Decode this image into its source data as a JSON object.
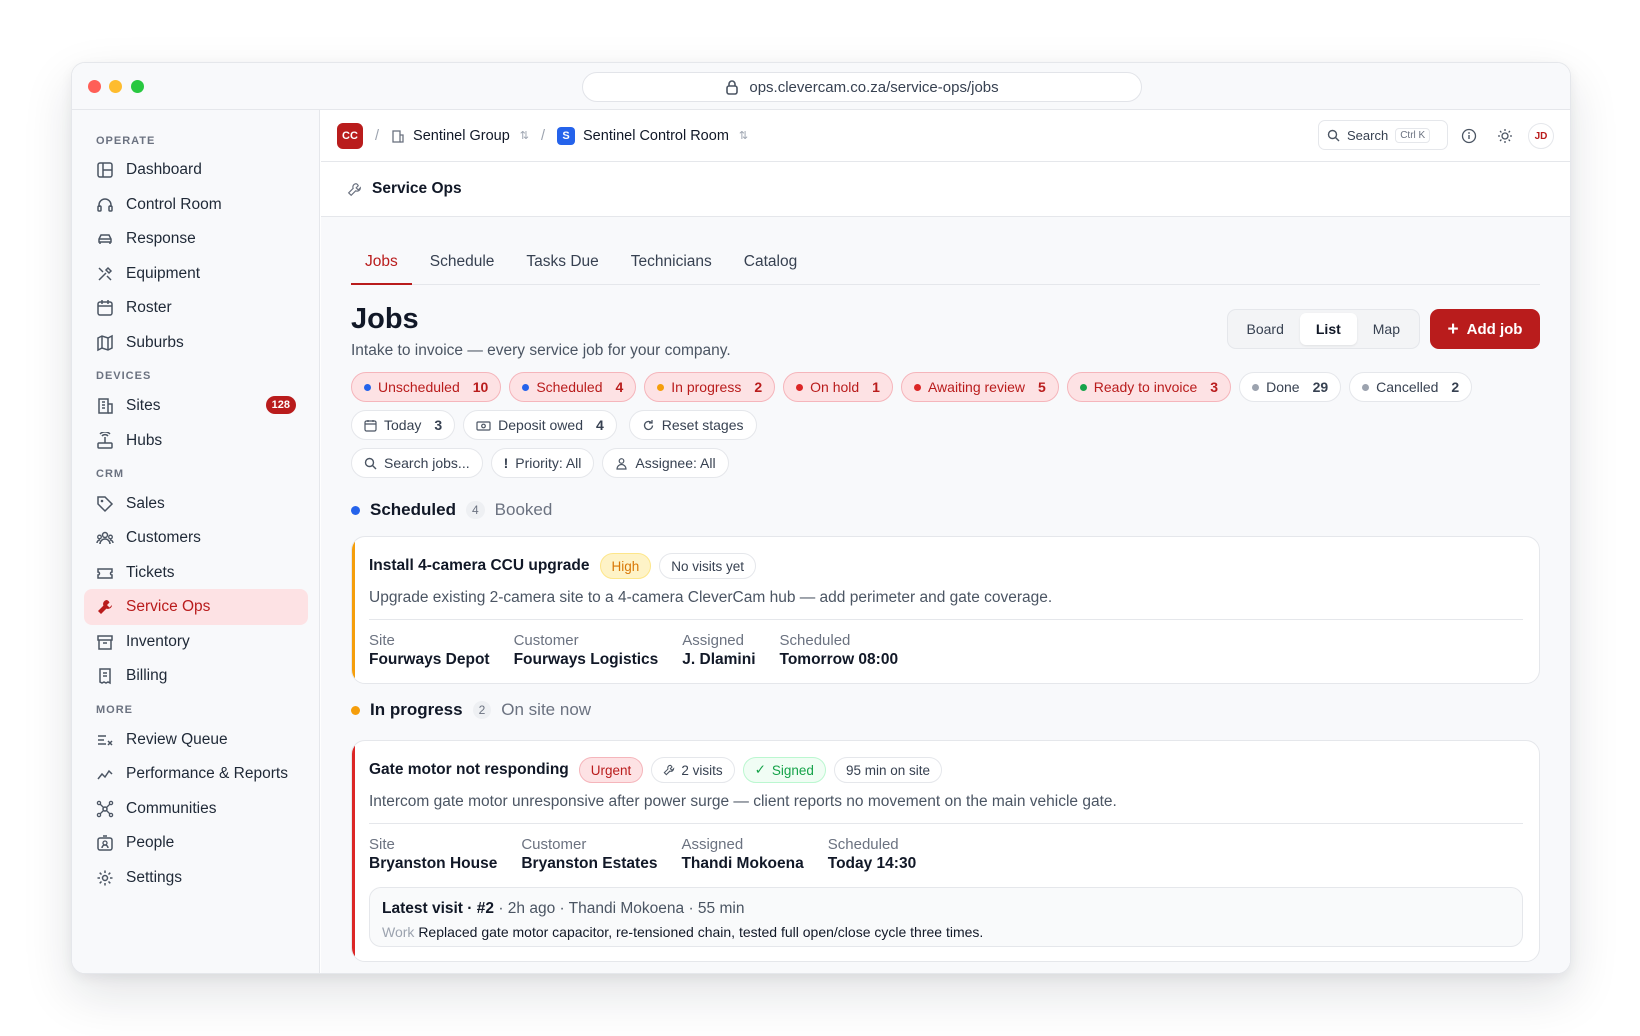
{
  "browser": {
    "url": "ops.clevercam.co.za/service-ops/jobs"
  },
  "sidebar": {
    "sections": [
      {
        "title": "OPERATE"
      },
      {
        "title": "DEVICES"
      },
      {
        "title": "CRM"
      },
      {
        "title": "MORE"
      }
    ],
    "items": [
      {
        "label": "Dashboard",
        "icon": "dashboard-icon"
      },
      {
        "label": "Control Room",
        "icon": "headset-icon"
      },
      {
        "label": "Response",
        "icon": "car-icon"
      },
      {
        "label": "Equipment",
        "icon": "tools-icon"
      },
      {
        "label": "Roster",
        "icon": "calendar-icon"
      },
      {
        "label": "Suburbs",
        "icon": "map-icon"
      },
      {
        "label": "Sites",
        "icon": "building-icon",
        "badge": "128"
      },
      {
        "label": "Hubs",
        "icon": "router-icon"
      },
      {
        "label": "Sales",
        "icon": "tag-icon"
      },
      {
        "label": "Customers",
        "icon": "users-icon"
      },
      {
        "label": "Tickets",
        "icon": "ticket-icon"
      },
      {
        "label": "Service Ops",
        "icon": "wrench-icon",
        "active": true
      },
      {
        "label": "Inventory",
        "icon": "archive-icon"
      },
      {
        "label": "Billing",
        "icon": "receipt-icon"
      },
      {
        "label": "Review Queue",
        "icon": "review-icon"
      },
      {
        "label": "Performance & Reports",
        "icon": "trend-icon"
      },
      {
        "label": "Communities",
        "icon": "network-icon"
      },
      {
        "label": "People",
        "icon": "id-card-icon"
      },
      {
        "label": "Settings",
        "icon": "gear-icon"
      }
    ]
  },
  "topbar": {
    "logo": "CC",
    "org": "Sentinel Group",
    "workspace_initial": "S",
    "workspace": "Sentinel Control Room",
    "search_label": "Search",
    "search_shortcut": "Ctrl K",
    "avatar": "JD"
  },
  "subbar": {
    "title": "Service Ops"
  },
  "tabs": [
    "Jobs",
    "Schedule",
    "Tasks Due",
    "Technicians",
    "Catalog"
  ],
  "page": {
    "title": "Jobs",
    "subtitle": "Intake to invoice — every service job for your company.",
    "views": [
      "Board",
      "List",
      "Map"
    ],
    "add_label": "Add job"
  },
  "stages": [
    {
      "label": "Unscheduled",
      "count": "10",
      "dot": "#2563eb",
      "style": "red"
    },
    {
      "label": "Scheduled",
      "count": "4",
      "dot": "#2563eb",
      "style": "red"
    },
    {
      "label": "In progress",
      "count": "2",
      "dot": "#f59e0b",
      "style": "red"
    },
    {
      "label": "On hold",
      "count": "1",
      "dot": "#dc2626",
      "style": "red"
    },
    {
      "label": "Awaiting review",
      "count": "5",
      "dot": "#dc2626",
      "style": "red"
    },
    {
      "label": "Ready to invoice",
      "count": "3",
      "dot": "#16a34a",
      "style": "red"
    },
    {
      "label": "Done",
      "count": "29",
      "dot": "#9ca3af",
      "style": "plain"
    },
    {
      "label": "Cancelled",
      "count": "2",
      "dot": "#9ca3af",
      "style": "plain"
    }
  ],
  "quick_filters": [
    {
      "label": "Today",
      "count": "3"
    },
    {
      "label": "Deposit owed",
      "count": "4"
    },
    {
      "label": "Reset stages"
    }
  ],
  "filters": {
    "search": "Search jobs...",
    "priority": "Priority: All",
    "assignee": "Assignee: All"
  },
  "groups": [
    {
      "name": "Scheduled",
      "count": "4",
      "tag": "Booked",
      "color": "#2563eb",
      "job": {
        "title": "Install 4-camera CCU upgrade",
        "priority": "High",
        "visits": "No visits yet",
        "description": "Upgrade existing 2-camera site to a 4-camera CleverCam hub — add perimeter and gate coverage.",
        "meta": [
          {
            "label": "Site",
            "value": "Fourways Depot"
          },
          {
            "label": "Customer",
            "value": "Fourways Logistics"
          },
          {
            "label": "Assigned",
            "value": "J. Dlamini"
          },
          {
            "label": "Scheduled",
            "value": "Tomorrow 08:00"
          }
        ]
      }
    },
    {
      "name": "In progress",
      "count": "2",
      "tag": "On site now",
      "color": "#f59e0b",
      "job": {
        "title": "Gate motor not responding",
        "priority": "Urgent",
        "visits": "2 visits",
        "signed": "Signed",
        "duration": "95 min on site",
        "description": "Intercom gate motor unresponsive after power surge — client reports no movement on the main vehicle gate.",
        "meta": [
          {
            "label": "Site",
            "value": "Bryanston House"
          },
          {
            "label": "Customer",
            "value": "Bryanston Estates"
          },
          {
            "label": "Assigned",
            "value": "Thandi Mokoena"
          },
          {
            "label": "Scheduled",
            "value": "Today 14:30"
          }
        ],
        "latest_visit": {
          "title": "Latest visit · #2",
          "info": "· 2h ago · Thandi Mokoena · 55 min",
          "work_label": "Work",
          "work": "Replaced gate motor capacitor, re-tensioned chain, tested full open/close cycle three times."
        }
      }
    }
  ]
}
